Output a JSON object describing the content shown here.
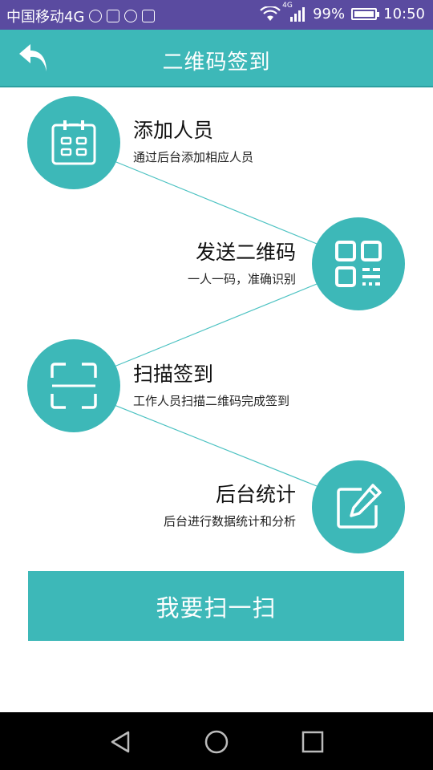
{
  "status_bar": {
    "carrier": "中国移动4G",
    "network": "4G",
    "battery": "99%",
    "battery_level": 0.99,
    "time": "10:50"
  },
  "header": {
    "title": "二维码签到",
    "back_icon": "back-arrow-icon"
  },
  "steps": [
    {
      "title": "添加人员",
      "subtitle": "通过后台添加相应人员",
      "icon": "calendar-icon"
    },
    {
      "title": "发送二维码",
      "subtitle": "一人一码，准确识别",
      "icon": "qr-code-icon"
    },
    {
      "title": "扫描签到",
      "subtitle": "工作人员扫描二维码完成签到",
      "icon": "scan-frame-icon"
    },
    {
      "title": "后台统计",
      "subtitle": "后台进行数据统计和分析",
      "icon": "edit-icon"
    }
  ],
  "scan_button": {
    "label": "我要扫一扫"
  },
  "colors": {
    "accent": "#3db8b8",
    "status_bar": "#5a4ba0"
  },
  "nav_bar": {
    "icons": [
      "back-triangle-icon",
      "home-circle-icon",
      "recents-square-icon"
    ]
  }
}
